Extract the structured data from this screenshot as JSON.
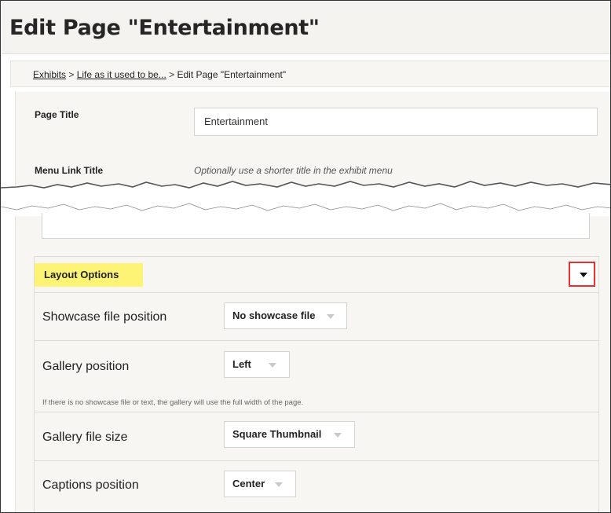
{
  "header": {
    "title": "Edit Page \"Entertainment\""
  },
  "breadcrumb": {
    "items": [
      {
        "label": "Exhibits"
      },
      {
        "label": "Life as it used to be..."
      }
    ],
    "separator": ">",
    "current": "Edit Page \"Entertainment\""
  },
  "form": {
    "page_title": {
      "label": "Page Title",
      "value": "Entertainment"
    },
    "menu_link_title": {
      "label": "Menu Link Title",
      "hint": "Optionally use a shorter title in the exhibit menu",
      "value": ""
    }
  },
  "layout_options": {
    "title": "Layout Options",
    "toggle_icon": "caret-down-icon",
    "highlight_color": "#fdf476",
    "callout_color": "#e33333",
    "rows": [
      {
        "label": "Showcase file position",
        "value": "No showcase file"
      },
      {
        "label": "Gallery position",
        "value": "Left",
        "help": "If there is no showcase file or text, the gallery will use the full width of the page."
      },
      {
        "label": "Gallery file size",
        "value": "Square Thumbnail"
      },
      {
        "label": "Captions position",
        "value": "Center"
      }
    ]
  }
}
